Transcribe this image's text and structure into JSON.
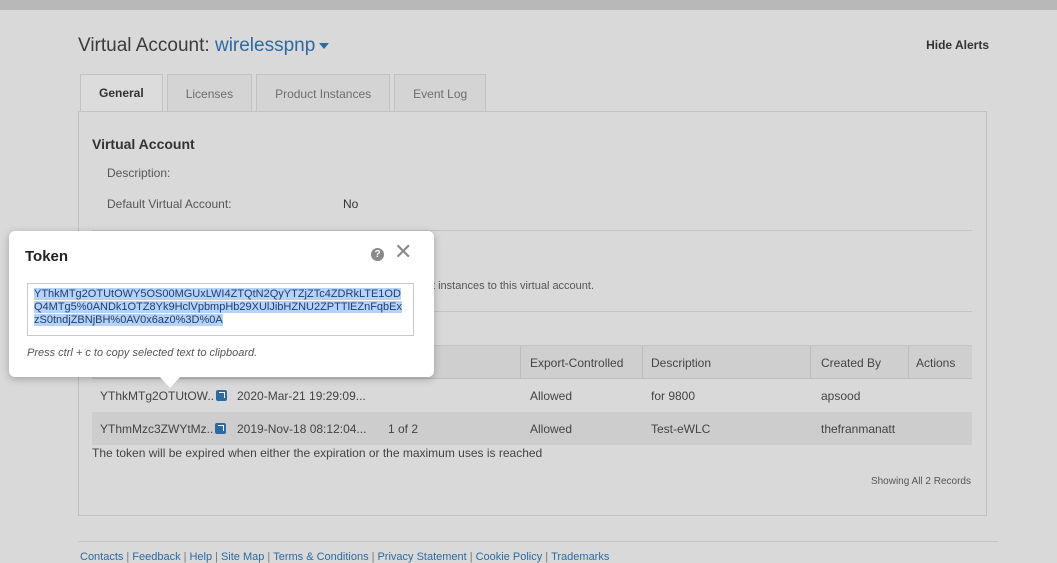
{
  "header": {
    "title_prefix": "Virtual Account:",
    "account_name": "wirelesspnp",
    "hide_alerts": "Hide Alerts"
  },
  "tabs": [
    {
      "label": "General",
      "active": true
    },
    {
      "label": "Licenses",
      "active": false
    },
    {
      "label": "Product Instances",
      "active": false
    },
    {
      "label": "Event Log",
      "active": false
    }
  ],
  "virtual_account": {
    "section_title": "Virtual Account",
    "description_label": "Description:",
    "description_value": "",
    "default_label": "Default Virtual Account:",
    "default_value": "No"
  },
  "partial_text": "t instances to this virtual account.",
  "table": {
    "headers": [
      "Export-Controlled",
      "Description",
      "Created By",
      "Actions"
    ],
    "rows": [
      {
        "token": "YThkMTg2OTUtOW..",
        "expiration": "2020-Mar-21 19:29:09...",
        "uses": "",
        "export": "Allowed",
        "description": "for 9800",
        "created_by": "apsood"
      },
      {
        "token": "YThmMzc3ZWYtMz..",
        "expiration": "2019-Nov-18 08:12:04...",
        "uses": "1 of 2",
        "export": "Allowed",
        "description": "Test-eWLC",
        "created_by": "thefranmanatt"
      }
    ]
  },
  "expire_note": "The token will be expired when either the expiration or the maximum uses is reached",
  "records_text": "Showing All 2 Records",
  "footer": {
    "links": [
      "Contacts",
      "Feedback",
      "Help",
      "Site Map",
      "Terms & Conditions",
      "Privacy Statement",
      "Cookie Policy",
      "Trademarks"
    ]
  },
  "popup": {
    "title": "Token",
    "token_value": "YThkMTg2OTUtOWY5OS00MGUxLWI4ZTQtN2QyYTZjZTc4ZDRkLTE1ODQ4MTg5%0ANDk1OTZ8Yk9HclVpbmpHb29XUlJibHZNU2ZPTTlEZnFqbExzS0tndjZBNjBH%0AV0x6az0%3D%0A",
    "hint": "Press ctrl + c to copy selected text to clipboard."
  },
  "colors": {
    "link": "#2c6aa0",
    "backdrop": "#d9d9d9",
    "selection": "#b5d3f7"
  }
}
